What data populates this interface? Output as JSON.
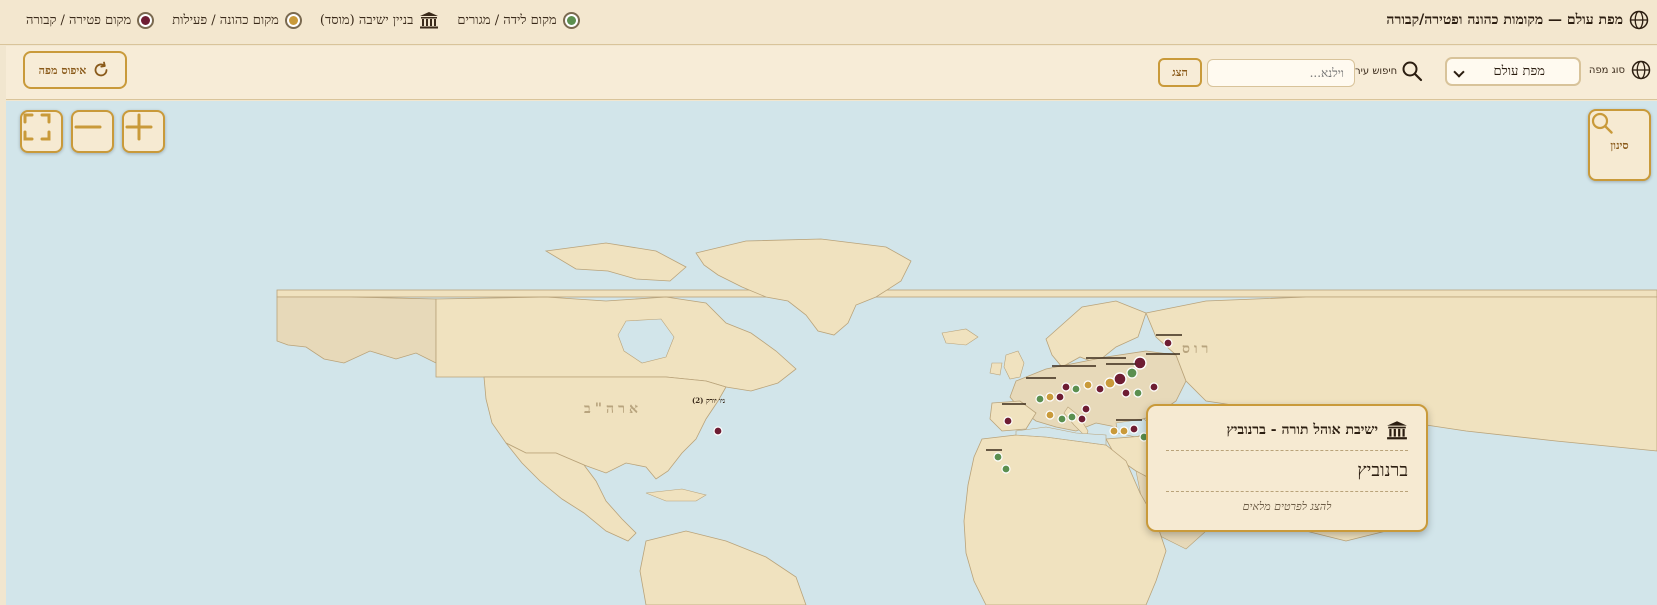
{
  "header": {
    "title": "מפת עולם — מקומות כהונה ופטירה/קבורה",
    "icon": "globe-icon",
    "legend": [
      {
        "label": "מקום לידה / מגורים",
        "kind": "birth",
        "color": "#5b8f4f"
      },
      {
        "label": "בניין ישיבה (מוסד)",
        "kind": "yeshiva",
        "icon": "building-icon"
      },
      {
        "label": "מקום כהונה / פעילות",
        "kind": "office",
        "color": "#c99a3a"
      },
      {
        "label": "מקום פטירה / קבורה",
        "kind": "death",
        "color": "#6e1d33"
      }
    ]
  },
  "toolbar": {
    "map_type_label": "סוג מפה",
    "map_type_value": "מפת עולם",
    "city_search_label": "חיפוש עיר",
    "search_placeholder": "וילנא...",
    "show_label": "הצג",
    "reset_label": "איפוס מפה"
  },
  "map": {
    "filter_label": "סינון",
    "region_labels": {
      "usa": "ארה\"ב",
      "russia": "רוס"
    },
    "usa_marker_label": "(2) ניו יורק",
    "colors": {
      "water": "#d2e5ea",
      "land": "#f0e2bf",
      "land_alt": "#e7d9b9",
      "border": "#b9a37a"
    }
  },
  "popup": {
    "title": "ישיבת אוהל תורה - ברנוביץ",
    "icon": "building-icon",
    "city": "ברנוביץ",
    "more_link": "להצג לפרטים מלאים"
  }
}
